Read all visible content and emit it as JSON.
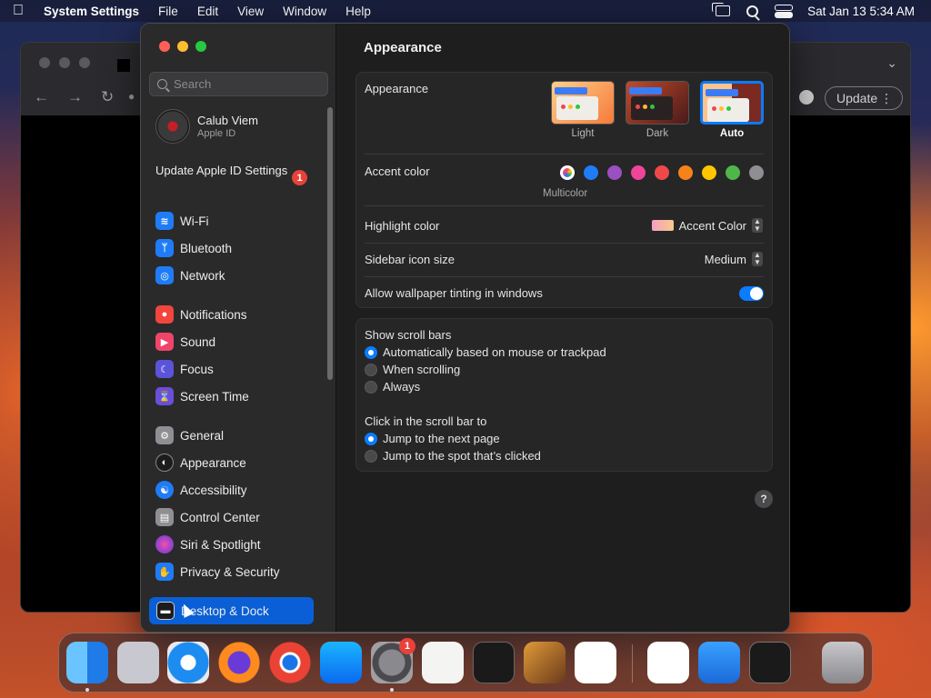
{
  "menubar": {
    "app_name": "System Settings",
    "items": [
      "File",
      "Edit",
      "View",
      "Window",
      "Help"
    ],
    "clock": "Sat Jan 13  5:34 AM"
  },
  "browser": {
    "update_label": "Update"
  },
  "sidebar": {
    "search_placeholder": "Search",
    "profile": {
      "name": "Calub Viem",
      "subtitle": "Apple ID"
    },
    "update_apple_id": {
      "label": "Update Apple ID Settings",
      "badge": "1"
    },
    "items": [
      {
        "label": "Wi-Fi",
        "icon": "wifi-icon",
        "color": "#1f7cf6"
      },
      {
        "label": "Bluetooth",
        "icon": "bluetooth-icon",
        "color": "#1f7cf6"
      },
      {
        "label": "Network",
        "icon": "globe-icon",
        "color": "#1f7cf6"
      },
      {
        "label": "Notifications",
        "icon": "bell-icon",
        "color": "#f2463c"
      },
      {
        "label": "Sound",
        "icon": "speaker-icon",
        "color": "#f0446a"
      },
      {
        "label": "Focus",
        "icon": "moon-icon",
        "color": "#5b53d8"
      },
      {
        "label": "Screen Time",
        "icon": "hourglass-icon",
        "color": "#6a4fd8"
      },
      {
        "label": "General",
        "icon": "gear-icon",
        "color": "#8e8e93"
      },
      {
        "label": "Appearance",
        "icon": "appearance-icon",
        "color": "#1c1c1e"
      },
      {
        "label": "Accessibility",
        "icon": "accessibility-icon",
        "color": "#1f7cf6"
      },
      {
        "label": "Control Center",
        "icon": "control-center-icon",
        "color": "#8e8e93"
      },
      {
        "label": "Siri & Spotlight",
        "icon": "siri-icon",
        "color": "#b44ad8"
      },
      {
        "label": "Privacy & Security",
        "icon": "hand-icon",
        "color": "#1f7cf6"
      },
      {
        "label": "Desktop & Dock",
        "icon": "dock-icon",
        "color": "#1c1c1e"
      }
    ],
    "selected": "Desktop & Dock"
  },
  "main": {
    "title": "Appearance",
    "appearance": {
      "label": "Appearance",
      "options": [
        "Light",
        "Dark",
        "Auto"
      ],
      "selected": "Auto"
    },
    "accent_color": {
      "label": "Accent color",
      "caption": "Multicolor",
      "colors": [
        "#c46dd8",
        "#1f7cf6",
        "#9a4fc2",
        "#f0449a",
        "#f0484a",
        "#f7821b",
        "#ffc600",
        "#4fb64a",
        "#8e8e93"
      ]
    },
    "highlight_color": {
      "label": "Highlight color",
      "value": "Accent Color"
    },
    "sidebar_icon_size": {
      "label": "Sidebar icon size",
      "value": "Medium"
    },
    "wallpaper_tinting": {
      "label": "Allow wallpaper tinting in windows",
      "enabled": true
    },
    "scroll_bars": {
      "label": "Show scroll bars",
      "options": [
        "Automatically based on mouse or trackpad",
        "When scrolling",
        "Always"
      ],
      "selected": 0
    },
    "click_scroll_bar": {
      "label": "Click in the scroll bar to",
      "options": [
        "Jump to the next page",
        "Jump to the spot that’s clicked"
      ],
      "selected": 0
    },
    "help": "?"
  },
  "dock": {
    "apps": [
      "finder",
      "launchpad",
      "safari",
      "firefox",
      "chrome",
      "app-store",
      "system-settings",
      "textedit",
      "terminal",
      "garageband",
      "vscode",
      "visual-studio",
      "weather",
      "activity-monitor",
      "trash"
    ],
    "settings_badge": "1"
  }
}
